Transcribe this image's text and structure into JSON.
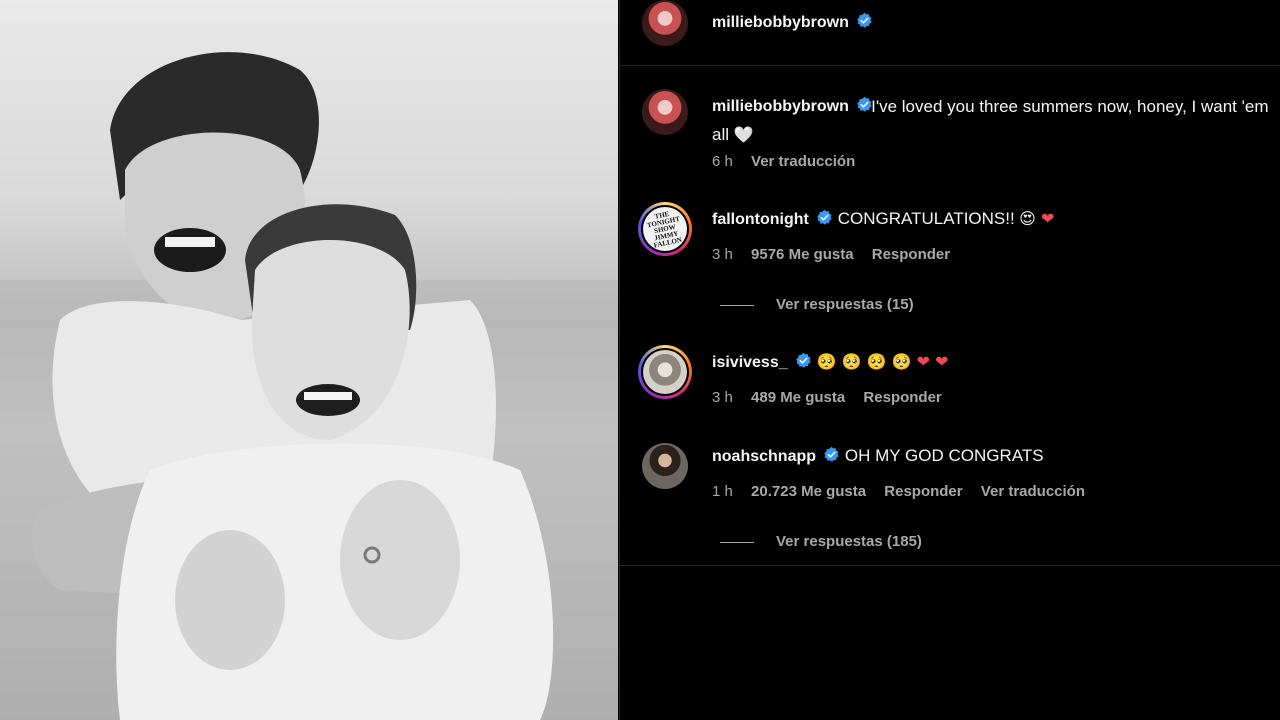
{
  "post": {
    "author": "milliebobbybrown",
    "caption": "I've loved you three summers now, honey, I want 'em all",
    "caption_emoji": "🤍",
    "time": "6 h",
    "translate_label": "Ver traducción"
  },
  "comments": [
    {
      "username": "fallontonight",
      "text": "CONGRATULATIONS!!",
      "emoji": "😍 ❤️",
      "time": "3 h",
      "likes": "9576 Me gusta",
      "reply_label": "Responder",
      "replies_label": "Ver respuestas (15)",
      "avatar_text": "THE TONIGHT SHOW JIMMY FALLON"
    },
    {
      "username": "isivivess_",
      "text": "",
      "emoji": "🥺 🥺 🥺 🥺 ❤️ ❤️",
      "time": "3 h",
      "likes": "489 Me gusta",
      "reply_label": "Responder"
    },
    {
      "username": "noahschnapp",
      "text": "OH MY GOD CONGRATS",
      "emoji": "",
      "time": "1 h",
      "likes": "20.723 Me gusta",
      "reply_label": "Responder",
      "translate_label": "Ver traducción",
      "replies_label": "Ver respuestas (185)"
    }
  ],
  "colors": {
    "background": "#000000",
    "text": "#f5f5f5",
    "muted": "#a8a8a8",
    "verified": "#3897f0",
    "heart_red": "#ed4956"
  }
}
